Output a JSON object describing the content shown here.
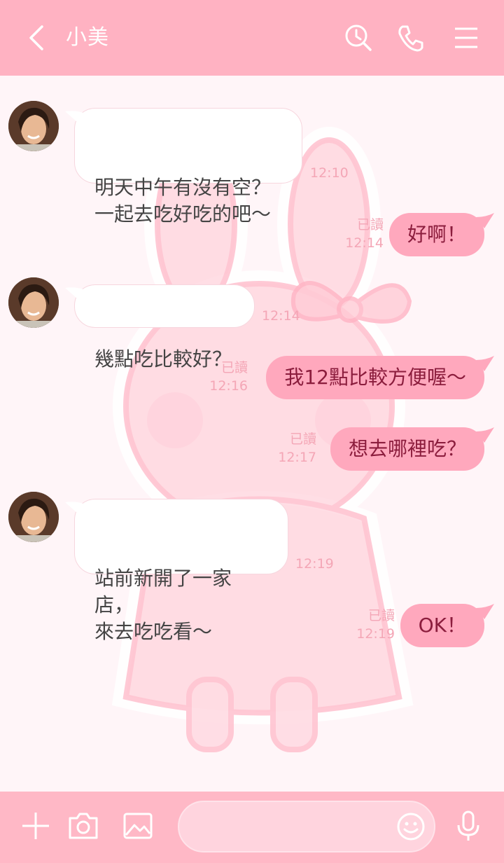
{
  "header": {
    "contact_name": "小美",
    "icons": [
      "back-chevron-icon",
      "search-history-icon",
      "phone-icon",
      "menu-icon"
    ]
  },
  "messages": [
    {
      "side": "in",
      "text": "明天中午有沒有空？\n一起去吃好吃的吧～",
      "time": "12:10"
    },
    {
      "side": "out",
      "text": "好啊！",
      "read": "已讀",
      "time": "12:14"
    },
    {
      "side": "in",
      "text": "幾點吃比較好？",
      "time": "12:14"
    },
    {
      "side": "out",
      "text": "我12點比較方便喔～",
      "read": "已讀",
      "time": "12:16"
    },
    {
      "side": "out",
      "text": "想去哪裡吃？",
      "read": "已讀",
      "time": "12:17"
    },
    {
      "side": "in",
      "text": "站前新開了一家店，\n來去吃吃看～",
      "time": "12:19"
    },
    {
      "side": "out",
      "text": "OK！",
      "read": "已讀",
      "time": "12:19"
    }
  ],
  "footer": {
    "input_value": "",
    "icons": [
      "plus-icon",
      "camera-icon",
      "image-icon",
      "emoji-icon",
      "microphone-icon"
    ]
  },
  "colors": {
    "header_bg": "#ffb2c2",
    "chat_bg": "#fff5f8",
    "outgoing_bubble": "#ffa8bd",
    "outgoing_text": "#8b1d3d",
    "timestamp": "#f4a6b6"
  }
}
